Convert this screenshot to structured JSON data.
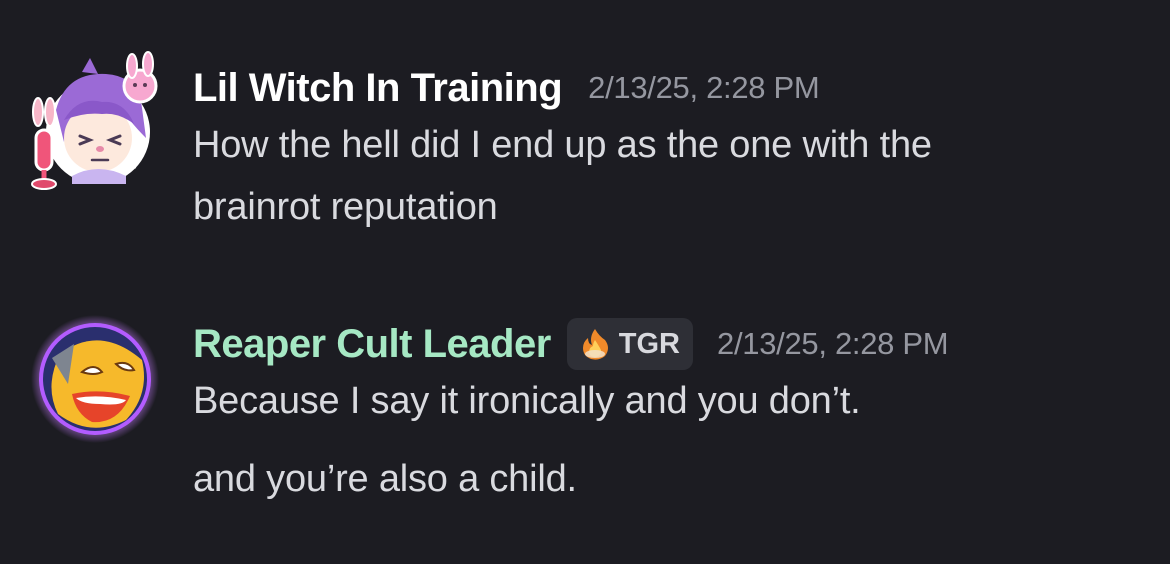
{
  "messages": [
    {
      "author": "Lil Witch In Training",
      "timestamp": "2/13/25, 2:28 PM",
      "lines": [
        "How the hell did I end up as the one with the",
        "brainrot reputation"
      ],
      "author_color": "#ffffff"
    },
    {
      "author": "Reaper Cult Leader",
      "timestamp": "2/13/25, 2:28 PM",
      "tag": {
        "icon": "flame-icon",
        "label": "TGR"
      },
      "lines": [
        "Because I say it ironically and you don’t.",
        "and you’re also a child."
      ],
      "author_color": "#a6e8c4"
    }
  ],
  "colors": {
    "background": "#1c1c22",
    "timestamp": "#9597a0",
    "message_text": "#d9dadf"
  }
}
